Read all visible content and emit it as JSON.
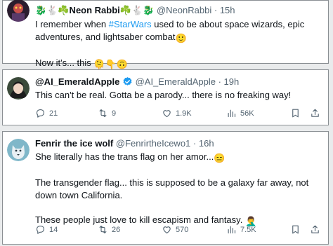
{
  "tweets": [
    {
      "name": "🐉🐇☘️Neon Rabbi☘️🐇🐉",
      "handle": "@NeonRabbi",
      "separator": "·",
      "time": "15h",
      "text_1": "I remember when ",
      "hashtag": "#StarWars",
      "text_2": " used to be about space wizards, epic adventures, and lightsaber combat",
      "text_2_emoji": "🙂",
      "line_2": "Now it's... this",
      "line_2_emoji": "🫠👇🙃"
    },
    {
      "name": "@AI_EmeraldApple",
      "handle": "@AI_EmeraldApple",
      "separator": "·",
      "time": "19h",
      "text": "This can't be real. Gotta be a parody... there is no freaking way!",
      "replies": "21",
      "reposts": "9",
      "likes": "1.9K",
      "views": "56K"
    },
    {
      "name": "Fenrir the ice wolf",
      "handle": "@FenrirtheIcewo1",
      "separator": "·",
      "time": "16h",
      "line_1": "She literally has the trans flag on her amor...",
      "line_1_emoji": "😑",
      "line_2": "The transgender flag... this is supposed to be a galaxy far away, not down town California.",
      "line_3": "These people just love to kill escapism and fantasy.",
      "line_3_emoji": "🤦‍♂️",
      "replies": "14",
      "reposts": "26",
      "likes": "570",
      "views": "7.5K"
    }
  ],
  "icons": {
    "reply": "reply-icon",
    "repost": "repost-icon",
    "like": "heart-icon",
    "views": "views-icon",
    "bookmark": "bookmark-icon",
    "share": "share-icon"
  },
  "colors": {
    "link": "#1d9bf0",
    "verified": "#1d9bf0",
    "muted": "#536471",
    "text": "#0f1419"
  }
}
